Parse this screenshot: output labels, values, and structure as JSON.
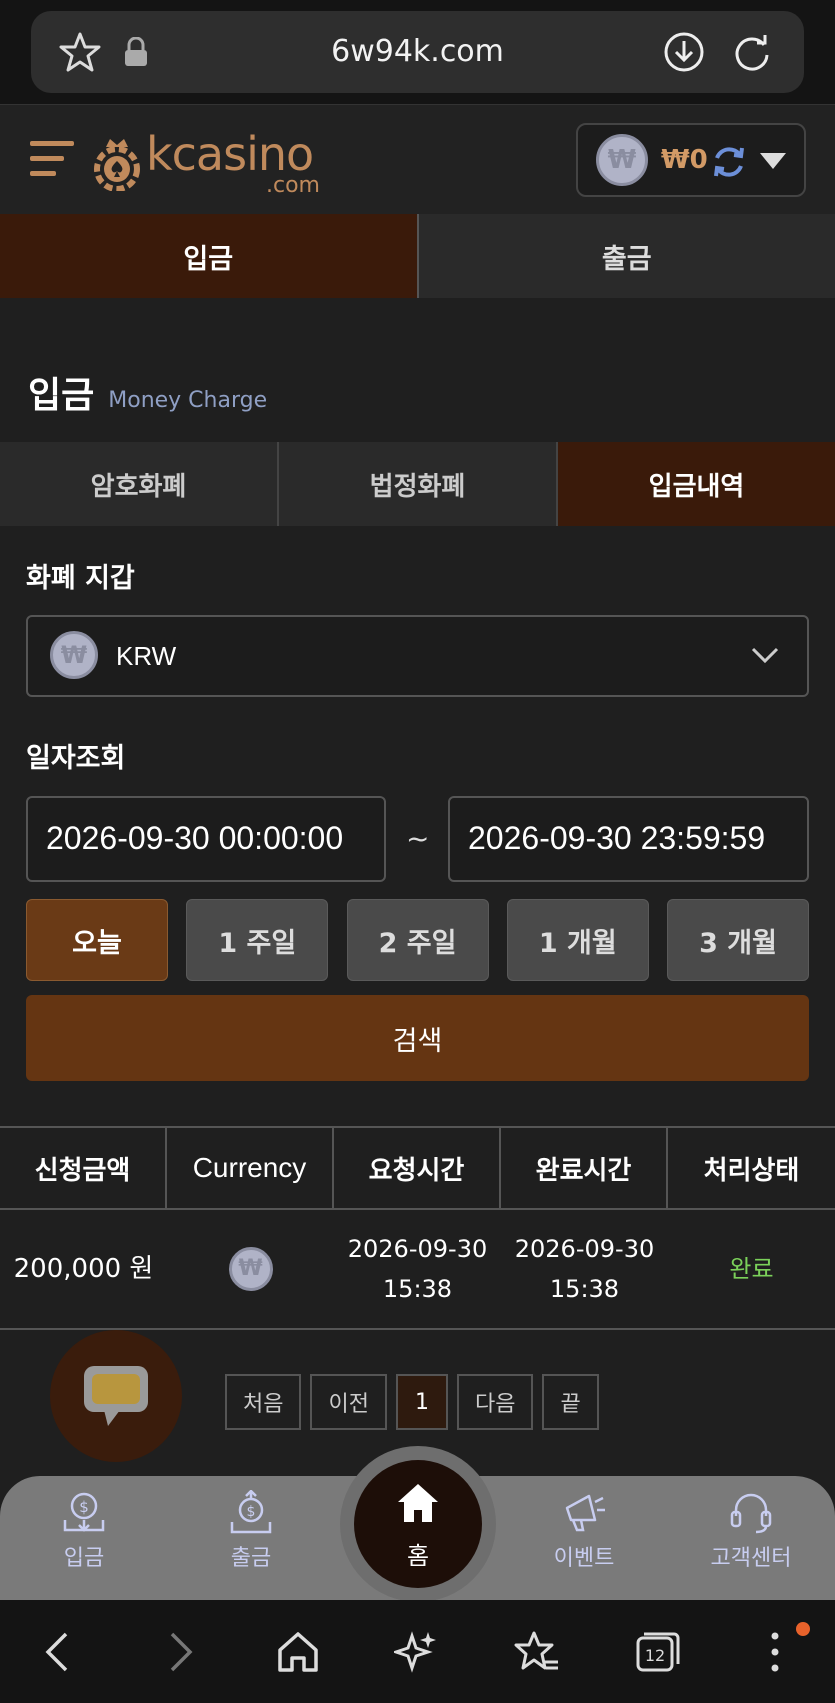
{
  "browser": {
    "url": "6w94k.com",
    "tab_count": "12"
  },
  "header": {
    "logo_text": "kcasino",
    "logo_sub": ".com",
    "wallet_symbol": "₩",
    "wallet_amount": "₩0"
  },
  "main_tabs": [
    {
      "label": "입금",
      "active": true
    },
    {
      "label": "출금",
      "active": false
    }
  ],
  "section": {
    "title": "입금",
    "subtitle": "Money Charge"
  },
  "sub_tabs": [
    {
      "label": "암호화폐",
      "active": false
    },
    {
      "label": "법정화폐",
      "active": false
    },
    {
      "label": "입금내역",
      "active": true
    }
  ],
  "wallet_select": {
    "label": "화폐 지갑",
    "value": "KRW",
    "coin_symbol": "₩"
  },
  "date_filter": {
    "label": "일자조회",
    "from": "2026-09-30 00:00:00",
    "to": "2026-09-30 23:59:59",
    "separator": "~"
  },
  "periods": [
    {
      "label": "오늘",
      "active": true
    },
    {
      "label": "1 주일",
      "active": false
    },
    {
      "label": "2 주일",
      "active": false
    },
    {
      "label": "1 개월",
      "active": false
    },
    {
      "label": "3 개월",
      "active": false
    }
  ],
  "search_label": "검색",
  "table": {
    "headers": [
      "신청금액",
      "Currency",
      "요청시간",
      "완료시간",
      "처리상태"
    ],
    "rows": [
      {
        "amount": "200,000 원",
        "currency_symbol": "₩",
        "request_date": "2026-09-30",
        "request_time": "15:38",
        "complete_date": "2026-09-30",
        "complete_time": "15:38",
        "status": "완료"
      }
    ]
  },
  "pagination": {
    "first": "처음",
    "prev": "이전",
    "current": "1",
    "next": "다음",
    "last": "끝"
  },
  "bottom_nav": {
    "deposit": "입금",
    "withdraw": "출금",
    "home": "홈",
    "event": "이벤트",
    "support": "고객센터"
  },
  "colors": {
    "accent_brown": "#653512",
    "active_tab": "#3a1a0a",
    "status_done": "#7bd15a",
    "logo": "#c08a5c"
  }
}
